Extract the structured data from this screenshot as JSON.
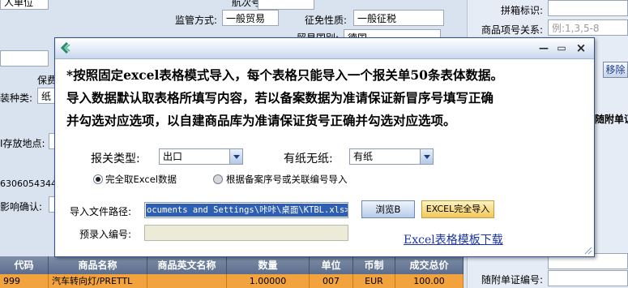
{
  "background": {
    "top_partial_left": "人单位",
    "top_partial_mid": "航次号",
    "supervision_label": "监管方式:",
    "supervision_value": "一般贸易",
    "levy_label": "征免性质:",
    "levy_value": "一般征税",
    "trade_country_label": "贸易国别:",
    "trade_country_value": "德国",
    "deposit_label": "保费",
    "pack_type_label": "装种类:",
    "pack_type_value": "纸",
    "storage_label": "I存放地点:",
    "number_value": "6306054344",
    "impact_label": "影响确认:",
    "right_panel": {
      "case_mark_label": "拼箱标识:",
      "item_relation_label": "商品项号关系:",
      "item_relation_placeholder": "例:1,3,5-8",
      "remove_button": "移除",
      "attach_doc_col": "随附单证",
      "attach_doc_no_label": "随附单证编号:"
    },
    "grid": {
      "headers": [
        "代码",
        "商品名称",
        "商品英文名称",
        "数量",
        "单位",
        "币制",
        "成交总价"
      ],
      "row": [
        "999",
        "汽车转向灯/PRETTL",
        "",
        "1.00000",
        "007",
        "EUR",
        "100.00"
      ]
    }
  },
  "dialog": {
    "controls": {
      "minimize": "—",
      "restore": "▭",
      "close": "×"
    },
    "notice_lines": [
      "*按照固定excel表格模式导入，每个表格只能导入一个报关单50条表体数据。",
      "导入数据默认取表格所填写内容，若以备案数据为准请保证新冒序号填写正确",
      "并勾选对应选项，以自建商品库为准请保证货号正确并勾选对应选项。"
    ],
    "declare_type_label": "报关类型:",
    "declare_type_value": "出口",
    "paper_label": "有纸无纸:",
    "paper_value": "有纸",
    "radio_excel_label": "完全取Excel数据",
    "radio_record_label": "根据备案序号或关联编号导入",
    "radio_selected": "excel",
    "path_label": "导入文件路径:",
    "path_value": "ocuments and Settings\\咔咔\\桌面\\KTBL.xls>",
    "browse_button": "浏览B",
    "import_button": "EXCEL完全导入",
    "pre_entry_label": "预录入编号:",
    "pre_entry_value": "",
    "template_link": "Excel表格模板下载",
    "colors": {
      "title_border": "#2e4f8c",
      "import_btn": "#f2c85a",
      "grid_row": "#f2a33e",
      "link": "#1a33a8"
    }
  }
}
